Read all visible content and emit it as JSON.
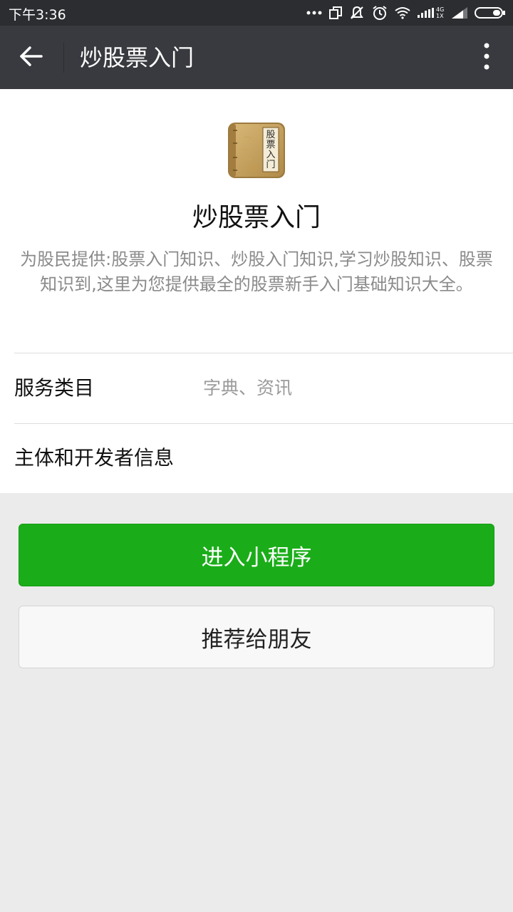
{
  "status_bar": {
    "time": "下午3:36",
    "network_label": "4G 1X",
    "icons": [
      "more-dots-icon",
      "copy-icon",
      "vibrate-off-icon",
      "alarm-icon",
      "wifi-icon",
      "signal-icon",
      "signal-icon",
      "battery-icon"
    ]
  },
  "nav": {
    "title": "炒股票入门",
    "back_icon": "back-arrow-icon",
    "more_icon": "more-vertical-icon"
  },
  "app": {
    "logo_icon": "book-logo-icon",
    "logo_text": "股票入门",
    "name": "炒股票入门",
    "description": "为股民提供:股票入门知识、炒股入门知识,学习炒股知识、股票知识到,这里为您提供最全的股票新手入门基础知识大全。"
  },
  "rows": {
    "service_category_label": "服务类目",
    "service_category_value": "字典、资讯",
    "developer_info_label": "主体和开发者信息"
  },
  "buttons": {
    "enter_label": "进入小程序",
    "recommend_label": "推荐给朋友"
  },
  "colors": {
    "status_bar": "#2b2d30",
    "nav_bar": "#393a3f",
    "primary": "#1aad19",
    "background": "#ebebeb"
  }
}
